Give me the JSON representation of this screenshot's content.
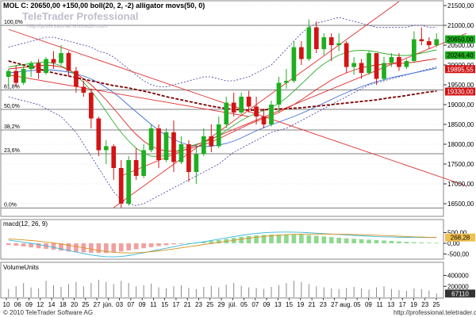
{
  "header": {
    "text": "MOL C: 20650,00 +150,00 boll(20, 2, -2) alligator movs(50, 0)",
    "logo": "TeleTrader Professional",
    "logo_url": "http://professional.teletrader.com"
  },
  "footer": {
    "copyright": "© 2010 TeleTrader Software AG",
    "url": "http://professional.teletrader.com"
  },
  "colors": {
    "up_candle": "#1fae1f",
    "down_candle": "#d21414",
    "ma50": "#7a0000",
    "boll": "#3a3aa0",
    "alligator_jaw": "#3f6fd8",
    "alligator_teeth": "#e02020",
    "alligator_lips": "#30b030",
    "trend_lines": "#e03030",
    "fib_lines": "#555555",
    "macd_line": "#38b8d8",
    "macd_signal": "#d89020",
    "volume_bars": "#8a8a8a"
  },
  "chart_data": [
    {
      "type": "candlestick",
      "title": "MOL C: 20650,00 +150,00 boll(20, 2, -2) alligator movs(50, 0)",
      "ylim": [
        16200,
        21600
      ],
      "y_ticks": [
        16500,
        17000,
        17500,
        18000,
        18500,
        19000,
        19500,
        20000,
        20500,
        21000,
        21500
      ],
      "y_tick_labels": [
        "16500,00",
        "17000,00",
        "17500,00",
        "18000,00",
        "18500,00",
        "19000,00",
        "19500,00",
        "20000,00",
        "20500,00",
        "21000,00",
        "21500,00"
      ],
      "x_tick_labels": [
        "10",
        "06",
        "09",
        "12",
        "14",
        "18",
        "20",
        "25",
        "27",
        "jún.",
        "03",
        "07",
        "09",
        "11",
        "15",
        "17",
        "21",
        "23",
        "25",
        "29",
        "júl.",
        "05",
        "07",
        "09",
        "13",
        "15",
        "19",
        "21",
        "23",
        "27",
        "aug.",
        "05",
        "09",
        "11",
        "13",
        "17",
        "19",
        "23",
        "25"
      ],
      "price_labels": [
        {
          "text": "20650,00",
          "value": 20650
        },
        {
          "text": "20246,40",
          "value": 20246
        },
        {
          "text": "19895,55",
          "value": 19895
        },
        {
          "text": "19330,00",
          "value": 19330
        }
      ],
      "fib_levels": [
        {
          "label": "100,0%",
          "value": 21000
        },
        {
          "label": "61,8%",
          "value": 19370
        },
        {
          "label": "50,0%",
          "value": 18880
        },
        {
          "label": "38,2%",
          "value": 18360
        },
        {
          "label": "23,6%",
          "value": 17760
        },
        {
          "label": "0,0%",
          "value": 16390
        }
      ],
      "candles": [
        [
          19700,
          19900,
          19500,
          19850
        ],
        [
          19850,
          20000,
          19450,
          19550
        ],
        [
          19550,
          20000,
          19500,
          19900
        ],
        [
          19900,
          20100,
          19700,
          20050
        ],
        [
          20050,
          20150,
          19650,
          19800
        ],
        [
          19800,
          20200,
          19750,
          20150
        ],
        [
          20150,
          20350,
          19900,
          20050
        ],
        [
          20050,
          20500,
          20000,
          20300
        ],
        [
          20300,
          20350,
          19700,
          19850
        ],
        [
          19850,
          19950,
          19300,
          19450
        ],
        [
          19450,
          19600,
          19200,
          19300
        ],
        [
          19300,
          19400,
          18400,
          18650
        ],
        [
          18650,
          18700,
          17700,
          17850
        ],
        [
          17850,
          18100,
          17500,
          17950
        ],
        [
          17950,
          18000,
          17100,
          17400
        ],
        [
          17400,
          17600,
          16400,
          16500
        ],
        [
          16500,
          17700,
          16450,
          17600
        ],
        [
          17600,
          17900,
          17100,
          17200
        ],
        [
          17200,
          18000,
          17150,
          17850
        ],
        [
          17850,
          18500,
          17800,
          18400
        ],
        [
          18400,
          18500,
          17400,
          17600
        ],
        [
          17600,
          18400,
          17550,
          18300
        ],
        [
          18300,
          18600,
          17300,
          17550
        ],
        [
          17550,
          18200,
          17500,
          18000
        ],
        [
          18000,
          18100,
          17050,
          17300
        ],
        [
          17300,
          18000,
          17000,
          17750
        ],
        [
          17750,
          18400,
          17700,
          18200
        ],
        [
          18200,
          18500,
          17800,
          17950
        ],
        [
          17950,
          18700,
          17900,
          18500
        ],
        [
          18500,
          19200,
          18400,
          19050
        ],
        [
          19050,
          19300,
          18700,
          18800
        ],
        [
          18800,
          19300,
          18750,
          19200
        ],
        [
          19200,
          19350,
          18800,
          18950
        ],
        [
          18950,
          19200,
          18500,
          18700
        ],
        [
          18700,
          18900,
          18400,
          18500
        ],
        [
          18500,
          19100,
          18450,
          19000
        ],
        [
          19000,
          19700,
          18800,
          19550
        ],
        [
          19550,
          19900,
          19400,
          19600
        ],
        [
          19600,
          20600,
          19550,
          20450
        ],
        [
          20450,
          20600,
          20000,
          20150
        ],
        [
          20150,
          21150,
          20100,
          20950
        ],
        [
          20950,
          21100,
          20300,
          20400
        ],
        [
          20400,
          20800,
          20250,
          20700
        ],
        [
          20700,
          20800,
          20100,
          20500
        ],
        [
          20500,
          20800,
          20350,
          20550
        ],
        [
          20550,
          20600,
          19800,
          19950
        ],
        [
          19950,
          20200,
          19750,
          20050
        ],
        [
          20050,
          20150,
          19650,
          19800
        ],
        [
          19800,
          20350,
          19750,
          20300
        ],
        [
          20300,
          20300,
          19500,
          19650
        ],
        [
          19650,
          20200,
          19600,
          20050
        ],
        [
          20050,
          20300,
          19950,
          20200
        ],
        [
          20200,
          20300,
          19850,
          19950
        ],
        [
          19950,
          20150,
          19900,
          20100
        ],
        [
          20100,
          20850,
          20050,
          20650
        ],
        [
          20650,
          20950,
          20500,
          20600
        ],
        [
          20600,
          20700,
          20400,
          20500
        ],
        [
          20500,
          20800,
          20450,
          20650
        ]
      ],
      "indicators": {
        "ma50": [
          20100,
          20050,
          20000,
          19950,
          19900,
          19850,
          19800,
          19760,
          19720,
          19680,
          19640,
          19600,
          19560,
          19520,
          19480,
          19450,
          19420,
          19380,
          19340,
          19300,
          19250,
          19200,
          19160,
          19120,
          19080,
          19040,
          19000,
          18960,
          18930,
          18900,
          18880,
          18870,
          18860,
          18860,
          18870,
          18880,
          18890,
          18900,
          18910,
          18920,
          18940,
          18960,
          18980,
          19000,
          19020,
          19040,
          19060,
          19080,
          19100,
          19120,
          19150,
          19180,
          19200,
          19230,
          19260,
          19290,
          19320,
          19340
        ],
        "boll_upper": [
          20450,
          20500,
          20550,
          20600,
          20650,
          20700,
          20700,
          20650,
          20600,
          20550,
          20500,
          20450,
          20350,
          20300,
          20200,
          20050,
          19900,
          19750,
          19600,
          19500,
          19450,
          19450,
          19500,
          19550,
          19600,
          19650,
          19700,
          19700,
          19650,
          19600,
          19600,
          19650,
          19700,
          19800,
          19900,
          20000,
          20200,
          20400,
          20600,
          20800,
          20950,
          21050,
          21100,
          21150,
          21200,
          21150,
          21100,
          21050,
          21000,
          20950,
          20950,
          20950,
          20950,
          20950,
          21000,
          21000,
          20950,
          20950
        ],
        "boll_lower": [
          19200,
          19150,
          19100,
          19050,
          19000,
          18900,
          18800,
          18700,
          18500,
          18300,
          18000,
          17700,
          17400,
          17100,
          16800,
          16600,
          16500,
          16450,
          16500,
          16600,
          16700,
          16800,
          16900,
          17000,
          17100,
          17200,
          17300,
          17400,
          17500,
          17650,
          17800,
          17900,
          18000,
          18100,
          18200,
          18300,
          18350,
          18400,
          18500,
          18600,
          18700,
          18800,
          18900,
          19000,
          19100,
          19200,
          19300,
          19400,
          19500,
          19550,
          19600,
          19650,
          19700,
          19750,
          19800,
          19850,
          19900,
          19950
        ],
        "jaw": [
          19800,
          19820,
          19840,
          19860,
          19870,
          19880,
          19870,
          19850,
          19820,
          19780,
          19720,
          19650,
          19550,
          19430,
          19300,
          19150,
          18980,
          18820,
          18660,
          18500,
          18350,
          18220,
          18120,
          18040,
          17980,
          17950,
          17940,
          17950,
          17980,
          18020,
          18080,
          18160,
          18250,
          18340,
          18420,
          18490,
          18560,
          18630,
          18700,
          18780,
          18860,
          18950,
          19040,
          19130,
          19220,
          19300,
          19380,
          19450,
          19520,
          19580,
          19630,
          19680,
          19720,
          19760,
          19800,
          19840,
          19880,
          19920
        ],
        "teeth": [
          19900,
          19920,
          19940,
          19960,
          19980,
          20000,
          19980,
          19950,
          19880,
          19780,
          19650,
          19500,
          19320,
          19120,
          18900,
          18680,
          18450,
          18250,
          18080,
          17950,
          17870,
          17830,
          17820,
          17840,
          17880,
          17930,
          17990,
          18060,
          18140,
          18230,
          18320,
          18410,
          18500,
          18580,
          18650,
          18720,
          18800,
          18900,
          19000,
          19120,
          19250,
          19380,
          19500,
          19620,
          19720,
          19800,
          19870,
          19930,
          19970,
          20000,
          20020,
          20030,
          20040,
          20050,
          20070,
          20100,
          20130,
          20160
        ],
        "lips": [
          19950,
          19980,
          20010,
          20040,
          20060,
          20080,
          20040,
          19980,
          19880,
          19740,
          19560,
          19350,
          19100,
          18830,
          18550,
          18300,
          18080,
          17900,
          17780,
          17700,
          17690,
          17720,
          17790,
          17880,
          17950,
          18000,
          18050,
          18120,
          18220,
          18350,
          18480,
          18600,
          18700,
          18780,
          18850,
          18930,
          19030,
          19170,
          19340,
          19520,
          19700,
          19880,
          20030,
          20150,
          20250,
          20320,
          20360,
          20370,
          20360,
          20330,
          20290,
          20260,
          20240,
          20240,
          20260,
          20300,
          20340,
          20380
        ]
      },
      "trend_lines": [
        {
          "from": [
            0,
            20900
          ],
          "to": [
            61,
            16950
          ]
        },
        {
          "from": [
            0,
            19750
          ],
          "to": [
            32,
            18700
          ]
        },
        {
          "from": [
            15,
            17200
          ],
          "to": [
            61,
            20800
          ]
        },
        {
          "from": [
            14,
            16400
          ],
          "to": [
            52,
            21600
          ]
        }
      ]
    },
    {
      "type": "line",
      "title": "macd(12, 26, 9)",
      "ylim": [
        -700,
        700
      ],
      "y_ticks": [
        -500,
        0,
        500
      ],
      "y_tick_labels": [
        "-500,00",
        "0,00",
        "500,00"
      ],
      "last_value_label": "268,28",
      "histogram": [
        -80,
        -110,
        -150,
        -190,
        -230,
        -260,
        -300,
        -340,
        -380,
        -400,
        -420,
        -440,
        -450,
        -450,
        -420,
        -380,
        -330,
        -280,
        -230,
        -180,
        -130,
        -90,
        -50,
        -20,
        10,
        30,
        60,
        100,
        150,
        200,
        250,
        300,
        340,
        370,
        390,
        400,
        405,
        410,
        410,
        400,
        380,
        350,
        320,
        290,
        260,
        230,
        210,
        190,
        170,
        150,
        130,
        110,
        90,
        70,
        50,
        40,
        30,
        20
      ],
      "macd": [
        150,
        100,
        50,
        0,
        -60,
        -120,
        -190,
        -260,
        -340,
        -410,
        -480,
        -540,
        -590,
        -620,
        -630,
        -610,
        -570,
        -510,
        -440,
        -370,
        -300,
        -230,
        -160,
        -90,
        -30,
        20,
        70,
        130,
        190,
        250,
        310,
        370,
        420,
        460,
        490,
        510,
        520,
        525,
        520,
        510,
        490,
        470,
        450,
        430,
        410,
        390,
        370,
        350,
        330,
        310,
        300,
        290,
        280,
        275,
        272,
        270,
        269,
        268
      ],
      "signal": [
        200,
        180,
        160,
        130,
        100,
        60,
        20,
        -30,
        -90,
        -150,
        -210,
        -270,
        -330,
        -380,
        -420,
        -440,
        -450,
        -440,
        -420,
        -390,
        -350,
        -310,
        -260,
        -210,
        -160,
        -110,
        -60,
        -10,
        40,
        90,
        140,
        190,
        240,
        280,
        320,
        350,
        380,
        400,
        415,
        425,
        430,
        430,
        428,
        425,
        420,
        415,
        410,
        400,
        390,
        375,
        360,
        345,
        330,
        315,
        300,
        290,
        280,
        275
      ]
    },
    {
      "type": "bar",
      "title": "VolumeUnits",
      "ylim": [
        0,
        480000
      ],
      "y_ticks": [
        200000,
        400000
      ],
      "y_tick_labels": [
        "200000",
        "400000"
      ],
      "last_value_label": "67110",
      "values": [
        150000,
        200000,
        260000,
        180000,
        160000,
        300000,
        220000,
        190000,
        240000,
        280000,
        200000,
        260000,
        320000,
        280000,
        240000,
        300000,
        260000,
        200000,
        220000,
        250000,
        180000,
        160000,
        200000,
        220000,
        170000,
        150000,
        190000,
        210000,
        180000,
        230000,
        260000,
        210000,
        180000,
        170000,
        150000,
        190000,
        220000,
        260000,
        300000,
        280000,
        240000,
        200000,
        180000,
        160000,
        150000,
        170000,
        190000,
        160000,
        140000,
        180000,
        200000,
        150000,
        130000,
        120000,
        160000,
        150000,
        120000,
        67110
      ]
    }
  ]
}
